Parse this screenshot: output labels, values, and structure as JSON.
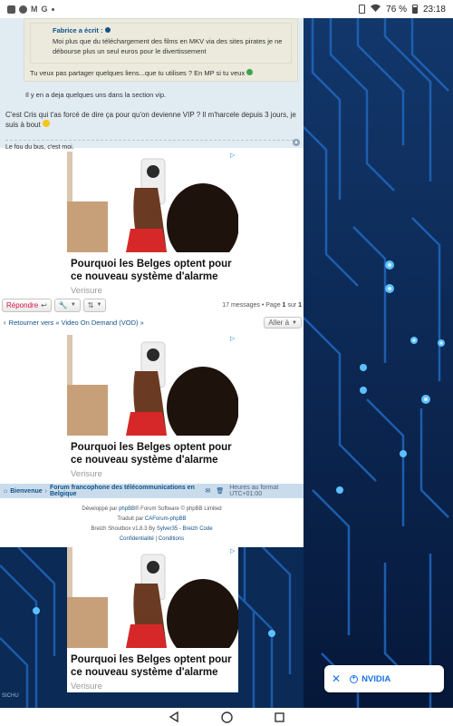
{
  "status_bar": {
    "left_icons": [
      "facebook-icon",
      "messenger-icon",
      "gmail-icon",
      "google-icon",
      "dot-icon"
    ],
    "battery": "76 %",
    "time": "23:18"
  },
  "post": {
    "quote_author": "Fabrice",
    "quote_author_suffix": "a écrit :",
    "quote_text": "Moi plus que du téléchargement des films en MKV via des sites pirates je ne débourse plus un seul euros pour le divertissement",
    "quote_reply": "Tu veux pas partager quelques liens...que tu utilises ? En MP si tu veux",
    "vip_line": "Il y en a deja quelques uns dans la section vip.",
    "main_text": "C'est Cris qui t'as forcé de dire ça pour qu'on devienne VIP ? Il m'harcele depuis 3 jours, je suis à bout",
    "signature": "Le fou du bus, c'est moi."
  },
  "ad": {
    "title": "Pourquoi les Belges optent pour ce nouveau système d'alarme",
    "source": "Verisure",
    "colors": {
      "door": "#ffffff",
      "frame": "#d9c7b0",
      "sleeve": "#d62828",
      "skin": "#6b3a22",
      "hair": "#1d120c",
      "camera": "#2a2a2a"
    }
  },
  "toolbar": {
    "reply_label": "Répondre",
    "message_count": "17 messages",
    "page_label": "• Page",
    "page_current": "1",
    "page_of": "sur",
    "page_total": "1"
  },
  "nav": {
    "return_label": "Retourner vers « Video On Demand (VOD) »",
    "jump_label": "Aller à"
  },
  "breadcrumb": {
    "home": "Bienvenue",
    "forum": "Forum francophone des télécommunications en Belgique",
    "timezone": "Heures au format UTC+01:00"
  },
  "footer": {
    "line1_prefix": "Développé par",
    "line1_link": "phpBB",
    "line1_suffix": "® Forum Software © phpBB Limited",
    "line2_prefix": "Traduit par",
    "line2_link": "CAForum-phpBB",
    "line3_prefix": "Breizh Shoutbox v1.8.3 By",
    "line3_link1": "Sylver35",
    "line3_mid": "-",
    "line3_link2": "Breizh Code",
    "privacy": "Confidentialité",
    "terms": "Conditions"
  },
  "watermark": "SICHU",
  "toast": {
    "label": "NVIDIA"
  }
}
